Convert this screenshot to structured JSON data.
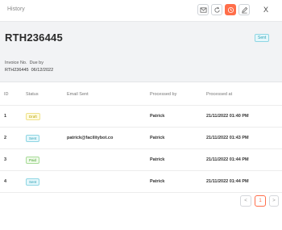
{
  "window": {
    "title": "History",
    "close_label": "X"
  },
  "toolbar": {
    "icons": [
      "mail-icon",
      "refresh-icon",
      "clock-icon",
      "edit-icon"
    ],
    "accent": "#ff6e4a"
  },
  "invoice": {
    "id": "RTH236445",
    "status": "Sent",
    "meta_headers": "Invoice No.  Due by",
    "meta_values": "RTH236445  06/12/2022"
  },
  "table": {
    "headers": {
      "id": "ID",
      "status": "Status",
      "email": "Email Sent",
      "by": "Processed by",
      "at": "Processed at"
    },
    "rows": [
      {
        "id": "1",
        "status": "Draft",
        "email": "",
        "by": "Patrick",
        "at": "21/11/2022 01:40 PM"
      },
      {
        "id": "2",
        "status": "Sent",
        "email": "patrick@facilitybot.co",
        "by": "Patrick",
        "at": "21/11/2022 01:43 PM"
      },
      {
        "id": "3",
        "status": "Paid",
        "email": "",
        "by": "Patrick",
        "at": "21/11/2022 01:44 PM"
      },
      {
        "id": "4",
        "status": "Sent",
        "email": "",
        "by": "Patrick",
        "at": "21/11/2022 01:44 PM"
      }
    ]
  },
  "pagination": {
    "prev": "<",
    "current": "1",
    "next": ">"
  }
}
